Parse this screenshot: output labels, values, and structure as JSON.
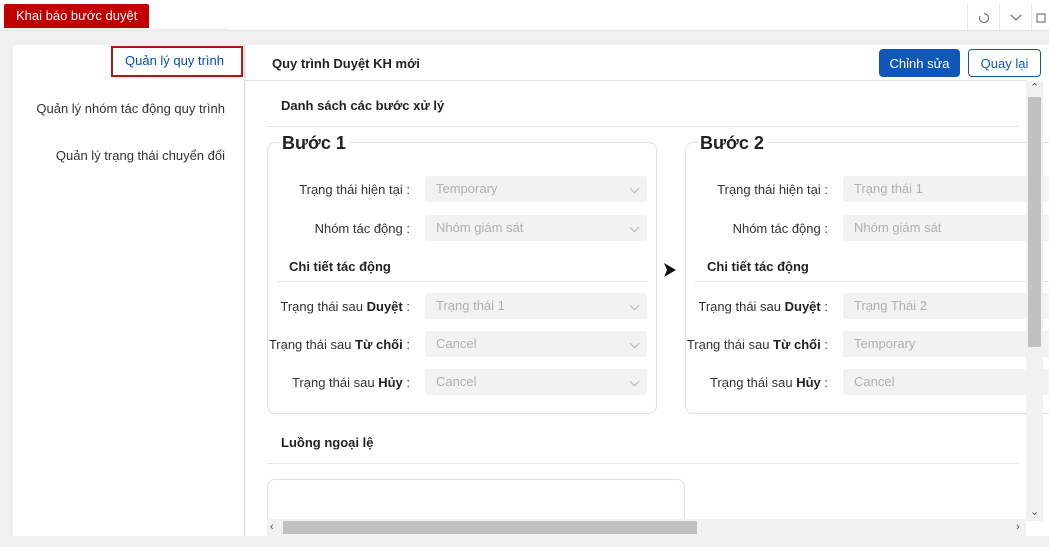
{
  "top": {
    "tab_label": "Khai báo bước duyệt"
  },
  "sidebar": {
    "items": [
      {
        "label": "Quản lý quy trình",
        "active": true
      },
      {
        "label": "Quản lý nhóm tác động quy trình",
        "active": false
      },
      {
        "label": "Quản lý trạng thái chuyển đổi",
        "active": false
      }
    ]
  },
  "main": {
    "title": "Quy trình Duyệt KH mới",
    "edit_button": "Chỉnh sửa",
    "back_button": "Quay lại",
    "steps_section": "Danh sách các bước xử lý",
    "exception_section": "Luồng ngoại lệ"
  },
  "labels": {
    "current_status": "Trạng thái hiện tại",
    "action_group": "Nhóm tác động",
    "action_detail": "Chi tiết tác động",
    "after_prefix": "Trạng thái sau ",
    "approve": "Duyệt",
    "reject": "Từ chối",
    "cancel": "Hủy",
    "colon": ":"
  },
  "steps": [
    {
      "title": "Bước 1",
      "current_status": "Temporary",
      "action_group": "Nhóm giám sát",
      "after_approve": "Trạng thái 1",
      "after_reject": "Cancel",
      "after_cancel": "Cancel"
    },
    {
      "title": "Bước 2",
      "current_status": "Trạng thái 1",
      "action_group": "Nhóm giám sát",
      "after_approve": "Trạng Thái 2",
      "after_reject": "Temporary",
      "after_cancel": "Cancel"
    }
  ],
  "colors": {
    "brand_red": "#c00000",
    "primary_blue": "#1057b8",
    "active_link": "#0050b3"
  }
}
